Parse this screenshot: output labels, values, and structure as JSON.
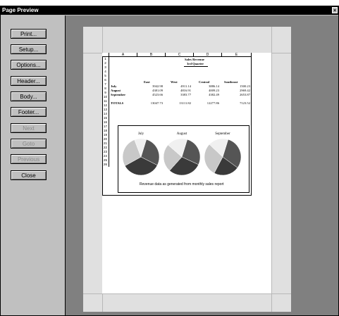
{
  "window": {
    "title": "Page Preview",
    "close_glyph": "×"
  },
  "buttons": [
    {
      "label": "Print...",
      "enabled": true
    },
    {
      "label": "Setup...",
      "enabled": true
    },
    {
      "label": "Options...",
      "enabled": true
    },
    {
      "label": "Header...",
      "enabled": true
    },
    {
      "label": "Body...",
      "enabled": true
    },
    {
      "label": "Footer...",
      "enabled": true
    },
    {
      "label": "Next",
      "enabled": false
    },
    {
      "label": "Goto",
      "enabled": false
    },
    {
      "label": "Previous",
      "enabled": false
    },
    {
      "label": "Close",
      "enabled": true
    }
  ],
  "sheet": {
    "columns": [
      "A",
      "B",
      "C",
      "D",
      "E"
    ],
    "rows": [
      "1",
      "2",
      "3",
      "4",
      "5",
      "6",
      "7",
      "8",
      "9",
      "10",
      "11",
      "12",
      "13",
      "14",
      "15",
      "16",
      "17",
      "18",
      "19",
      "20",
      "21",
      "22",
      "23",
      "24",
      "25",
      "26"
    ],
    "title_line1": "Sales Revenue",
    "title_line2": "3rd Quarter",
    "headers": [
      "East",
      "West",
      "Central",
      "Southeast"
    ],
    "data_rows": [
      {
        "label": "July",
        "values": [
          "3942.98",
          "4911.14",
          "3886.14",
          "1500.23"
        ]
      },
      {
        "label": "August",
        "values": [
          "4381.09",
          "4816.91",
          "4009.23",
          "2969.42"
        ]
      },
      {
        "label": "September",
        "values": [
          "4523.66",
          "3383.77",
          "4382.49",
          "2653.87"
        ]
      }
    ],
    "total_row": {
      "label": "TOTALS",
      "values": [
        "13047.73",
        "13111.82",
        "12277.86",
        "7123.52"
      ]
    }
  },
  "chart_data": {
    "type": "pie",
    "charts": [
      {
        "title": "July",
        "values": [
          3942.98,
          4911.14,
          3886.14,
          1500.23
        ],
        "series": [
          "East",
          "West",
          "Central",
          "Southeast"
        ]
      },
      {
        "title": "August",
        "values": [
          4381.09,
          4816.91,
          4009.23,
          2969.42
        ],
        "series": [
          "East",
          "West",
          "Central",
          "Southeast"
        ]
      },
      {
        "title": "September",
        "values": [
          4523.66,
          3383.77,
          4382.49,
          2653.87
        ],
        "series": [
          "East",
          "West",
          "Central",
          "Southeast"
        ]
      }
    ],
    "colors": [
      "#555555",
      "#3a3a3a",
      "#c8c8c8",
      "#f0f0f0"
    ],
    "caption": "Revenue data as generated from monthly sales report"
  }
}
